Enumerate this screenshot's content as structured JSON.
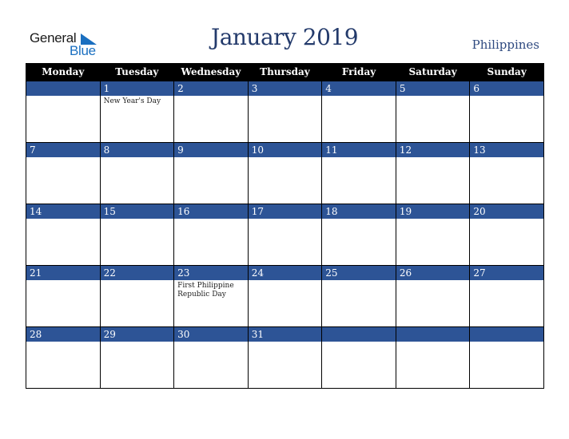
{
  "logo": {
    "text_general": "General",
    "text_blue": "Blue"
  },
  "title": "January 2019",
  "country": "Philippines",
  "colors": {
    "header_bg": "#000000",
    "day_bar": "#2d5496",
    "title": "#233a6b",
    "logo_blue": "#1a6fc0"
  },
  "weekdays": [
    "Monday",
    "Tuesday",
    "Wednesday",
    "Thursday",
    "Friday",
    "Saturday",
    "Sunday"
  ],
  "weeks": [
    [
      {
        "day": "",
        "event": ""
      },
      {
        "day": "1",
        "event": "New Year's Day"
      },
      {
        "day": "2",
        "event": ""
      },
      {
        "day": "3",
        "event": ""
      },
      {
        "day": "4",
        "event": ""
      },
      {
        "day": "5",
        "event": ""
      },
      {
        "day": "6",
        "event": ""
      }
    ],
    [
      {
        "day": "7",
        "event": ""
      },
      {
        "day": "8",
        "event": ""
      },
      {
        "day": "9",
        "event": ""
      },
      {
        "day": "10",
        "event": ""
      },
      {
        "day": "11",
        "event": ""
      },
      {
        "day": "12",
        "event": ""
      },
      {
        "day": "13",
        "event": ""
      }
    ],
    [
      {
        "day": "14",
        "event": ""
      },
      {
        "day": "15",
        "event": ""
      },
      {
        "day": "16",
        "event": ""
      },
      {
        "day": "17",
        "event": ""
      },
      {
        "day": "18",
        "event": ""
      },
      {
        "day": "19",
        "event": ""
      },
      {
        "day": "20",
        "event": ""
      }
    ],
    [
      {
        "day": "21",
        "event": ""
      },
      {
        "day": "22",
        "event": ""
      },
      {
        "day": "23",
        "event": "First Philippine Republic Day"
      },
      {
        "day": "24",
        "event": ""
      },
      {
        "day": "25",
        "event": ""
      },
      {
        "day": "26",
        "event": ""
      },
      {
        "day": "27",
        "event": ""
      }
    ],
    [
      {
        "day": "28",
        "event": ""
      },
      {
        "day": "29",
        "event": ""
      },
      {
        "day": "30",
        "event": ""
      },
      {
        "day": "31",
        "event": ""
      },
      {
        "day": "",
        "event": ""
      },
      {
        "day": "",
        "event": ""
      },
      {
        "day": "",
        "event": ""
      }
    ]
  ]
}
